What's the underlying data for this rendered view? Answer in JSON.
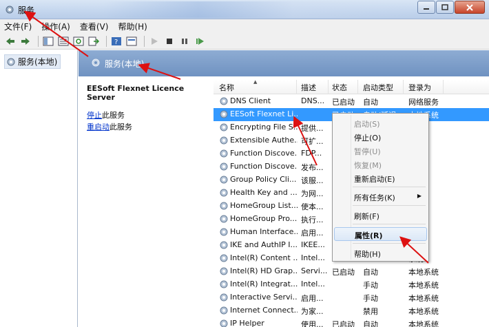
{
  "window": {
    "title": "服务"
  },
  "menubar": [
    "文件(F)",
    "操作(A)",
    "查看(V)",
    "帮助(H)"
  ],
  "tree": {
    "root_label": "服务(本地)"
  },
  "header": {
    "title": "服务(本地)"
  },
  "detail": {
    "service_name": "EESoft Flexnet Licence Server",
    "stop_link": "停止",
    "stop_suffix": "此服务",
    "restart_link": "重启动",
    "restart_suffix": "此服务"
  },
  "columns": [
    "名称",
    "描述",
    "状态",
    "启动类型",
    "登录为"
  ],
  "rows": [
    {
      "name": "DNS Client",
      "desc": "DNS...",
      "status": "已启动",
      "startup": "自动",
      "logon": "网络服务",
      "selected": false
    },
    {
      "name": "EESoft Flexnet Li...",
      "desc": "",
      "status": "已启动",
      "startup": "自动(延迟...",
      "logon": "本地系统",
      "selected": true
    },
    {
      "name": "Encrypting File S...",
      "desc": "提供...",
      "status": "",
      "startup": "",
      "logon": "系统",
      "selected": false
    },
    {
      "name": "Extensible Authe...",
      "desc": "可扩...",
      "status": "",
      "startup": "",
      "logon": "系统",
      "selected": false
    },
    {
      "name": "Function Discove...",
      "desc": "FDP...",
      "status": "",
      "startup": "",
      "logon": "服务",
      "selected": false
    },
    {
      "name": "Function Discove...",
      "desc": "发布...",
      "status": "",
      "startup": "",
      "logon": "服务",
      "selected": false
    },
    {
      "name": "Group Policy Cli...",
      "desc": "该服...",
      "status": "",
      "startup": "",
      "logon": "系统",
      "selected": false
    },
    {
      "name": "Health Key and ...",
      "desc": "为网...",
      "status": "",
      "startup": "",
      "logon": "系统",
      "selected": false
    },
    {
      "name": "HomeGroup List...",
      "desc": "使本...",
      "status": "",
      "startup": "",
      "logon": "系统",
      "selected": false
    },
    {
      "name": "HomeGroup Pro...",
      "desc": "执行...",
      "status": "",
      "startup": "",
      "logon": "服务",
      "selected": false
    },
    {
      "name": "Human Interface...",
      "desc": "启用...",
      "status": "",
      "startup": "",
      "logon": "系统",
      "selected": false
    },
    {
      "name": "IKE and AuthIP I...",
      "desc": "IKEE...",
      "status": "",
      "startup": "",
      "logon": "系统",
      "selected": false
    },
    {
      "name": "Intel(R) Content ...",
      "desc": "Intel...",
      "status": "",
      "startup": "",
      "logon": "系统",
      "selected": false
    },
    {
      "name": "Intel(R) HD Grap...",
      "desc": "Servi...",
      "status": "已启动",
      "startup": "自动",
      "logon": "本地系统",
      "selected": false
    },
    {
      "name": "Intel(R) Integrat...",
      "desc": "Intel...",
      "status": "",
      "startup": "手动",
      "logon": "本地系统",
      "selected": false
    },
    {
      "name": "Interactive Servi...",
      "desc": "启用...",
      "status": "",
      "startup": "手动",
      "logon": "本地系统",
      "selected": false
    },
    {
      "name": "Internet Connect...",
      "desc": "为家...",
      "status": "",
      "startup": "禁用",
      "logon": "本地系统",
      "selected": false
    },
    {
      "name": "IP Helper",
      "desc": "使用...",
      "status": "已启动",
      "startup": "自动",
      "logon": "本地系统",
      "selected": false
    }
  ],
  "context_menu": {
    "start": "启动(S)",
    "stop": "停止(O)",
    "pause": "暂停(U)",
    "resume": "恢复(M)",
    "restart": "重新启动(E)",
    "all_tasks": "所有任务(K)",
    "refresh": "刷新(F)",
    "properties": "属性(R)",
    "help": "帮助(H)"
  },
  "colors": {
    "selection": "#3399ff",
    "annotation_arrow": "#dd1111",
    "link": "#0033cc"
  }
}
